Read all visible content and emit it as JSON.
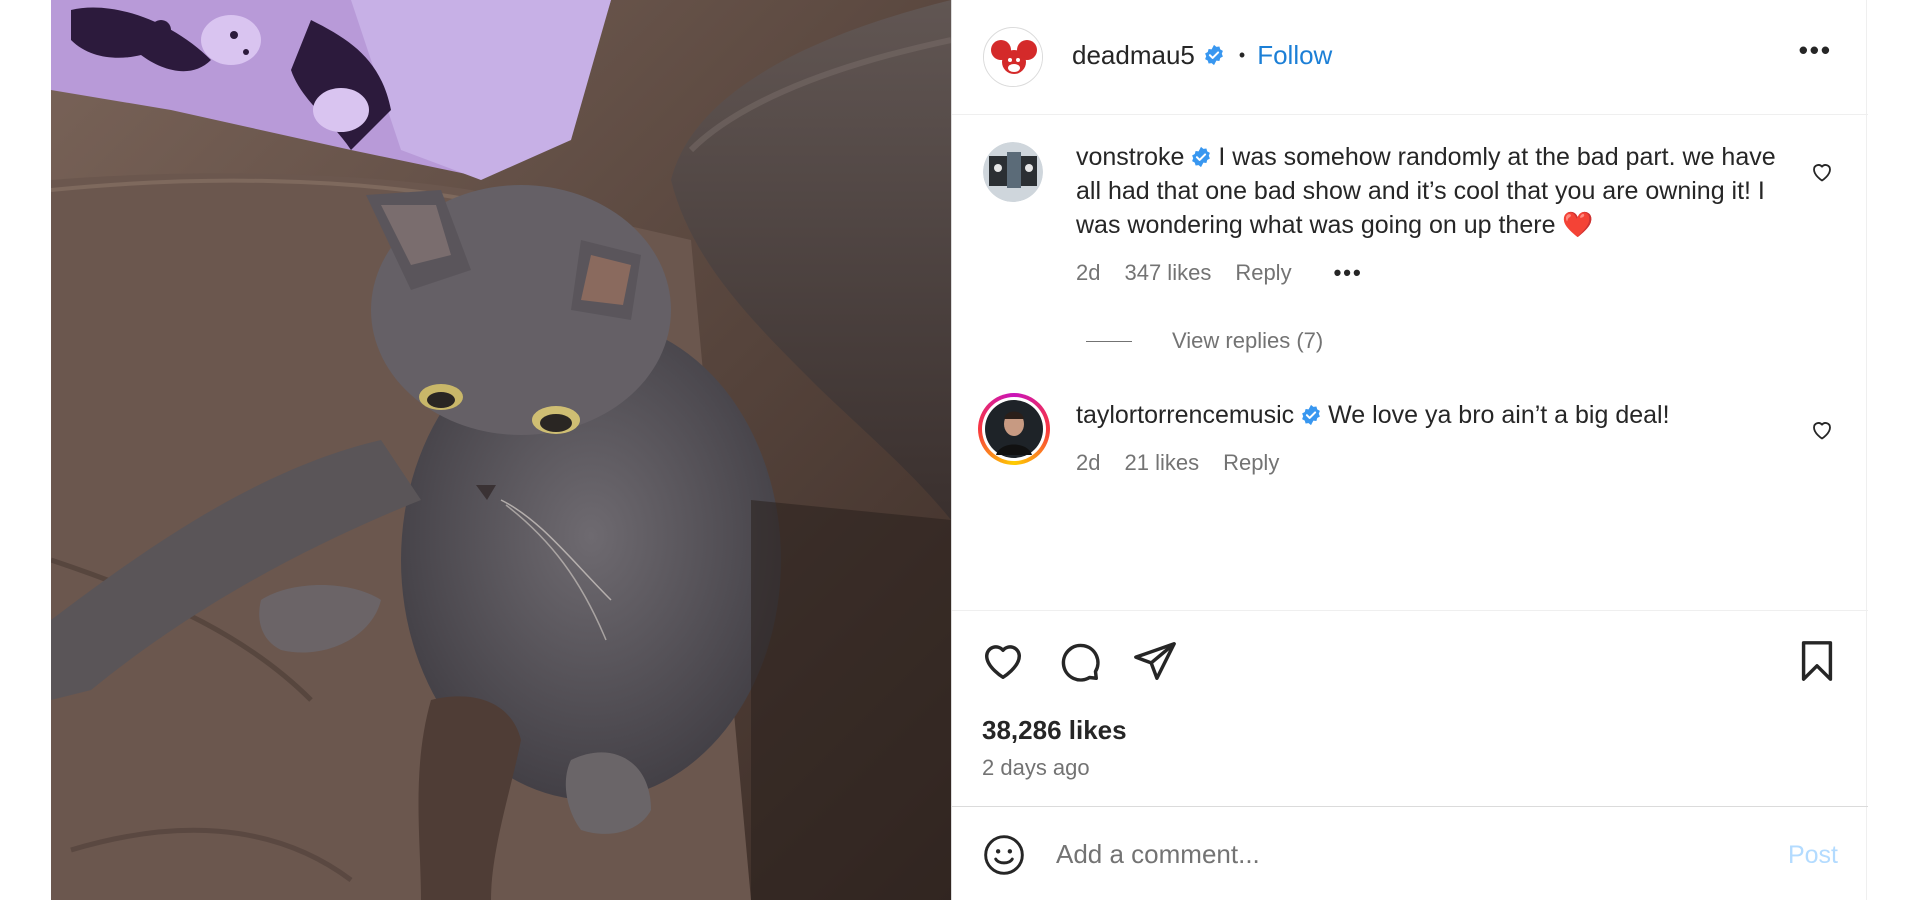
{
  "post": {
    "author": "deadmau5",
    "follow_label": "Follow",
    "separator": "•",
    "more_label": "•••",
    "likes_text": "38,286 likes",
    "time_ago": "2 days ago"
  },
  "comments": [
    {
      "user": "vonstroke",
      "text": "I was somehow randomly at the bad part. we have all had that one bad show and it’s cool that you are owning it! I was wondering what was going on up there",
      "emoji": "❤️",
      "age": "2d",
      "likes": "347 likes",
      "reply_label": "Reply",
      "more_label": "•••",
      "view_replies": "View replies (7)"
    },
    {
      "user": "taylortorrencemusic",
      "text": "We love ya bro ain’t a big deal!",
      "age": "2d",
      "likes": "21 likes",
      "reply_label": "Reply"
    }
  ],
  "add_comment": {
    "placeholder": "Add a comment...",
    "post_label": "Post"
  },
  "colors": {
    "accent": "#1c7fd6",
    "verified": "#3897f0",
    "muted_text": "#737373",
    "post_disabled": "#b3dbff"
  },
  "icons": {
    "like": "heart-icon",
    "comment": "comment-icon",
    "share": "paper-plane-icon",
    "save": "bookmark-icon",
    "emoji": "smiley-icon",
    "verified": "verified-badge-icon"
  }
}
